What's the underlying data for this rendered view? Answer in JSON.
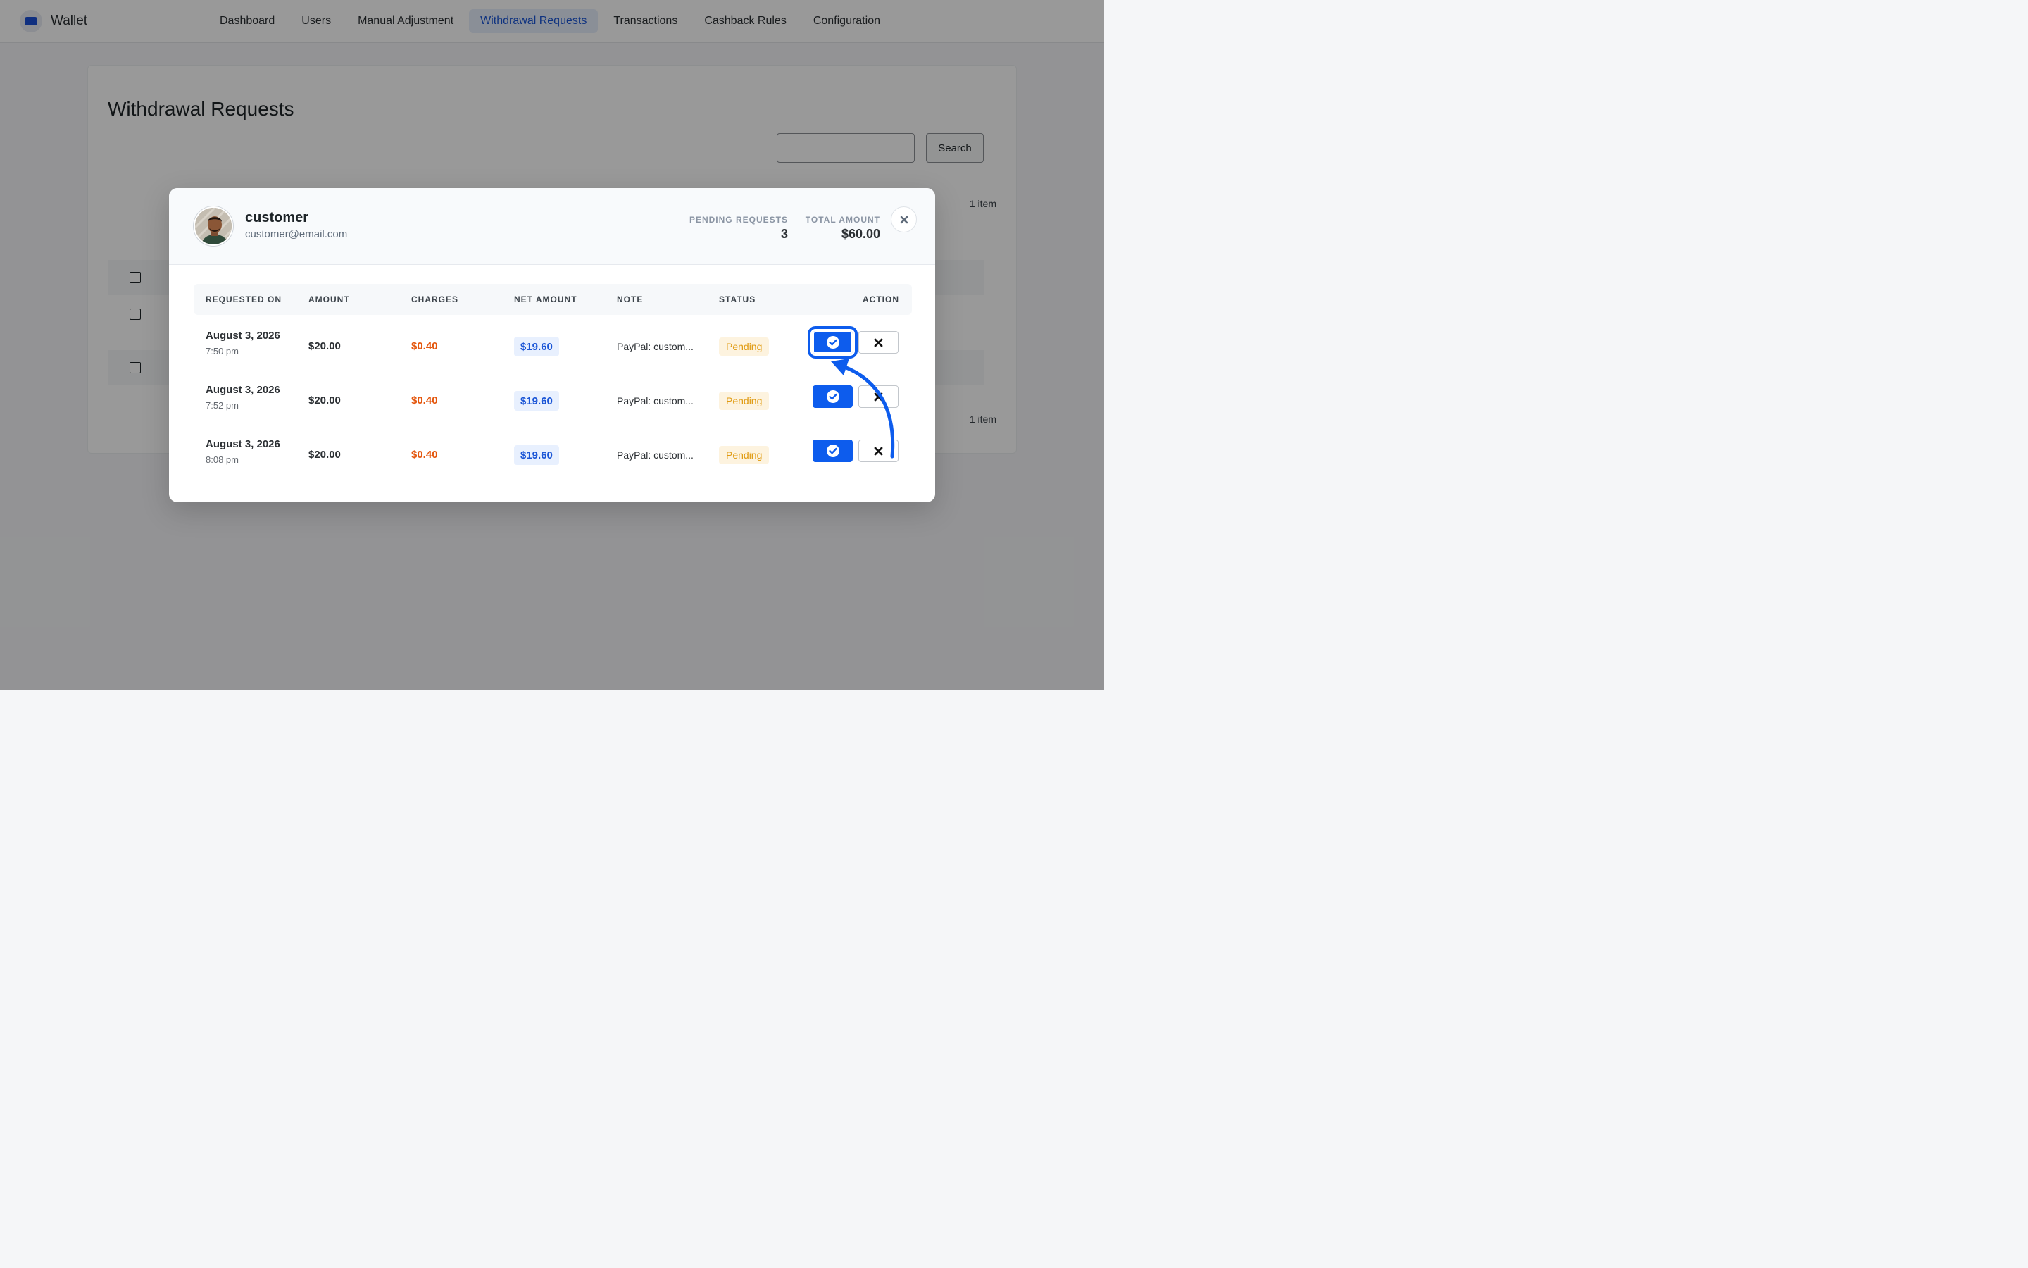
{
  "app": {
    "name": "Wallet"
  },
  "nav": {
    "items": [
      {
        "label": "Dashboard"
      },
      {
        "label": "Users"
      },
      {
        "label": "Manual Adjustment"
      },
      {
        "label": "Withdrawal Requests"
      },
      {
        "label": "Transactions"
      },
      {
        "label": "Cashback Rules"
      },
      {
        "label": "Configuration"
      }
    ],
    "active_index": 3
  },
  "page": {
    "title": "Withdrawal Requests",
    "search_button": "Search",
    "item_count_top": "1 item",
    "item_count_bottom": "1 item"
  },
  "modal": {
    "user_name": "customer",
    "user_email": "customer@email.com",
    "pending_label": "PENDING REQUESTS",
    "pending_value": "3",
    "total_label": "TOTAL AMOUNT",
    "total_value": "$60.00",
    "columns": [
      "REQUESTED ON",
      "AMOUNT",
      "CHARGES",
      "NET AMOUNT",
      "NOTE",
      "STATUS",
      "ACTION"
    ],
    "rows": [
      {
        "date": "August 3, 2026",
        "time": "7:50 pm",
        "amount": "$20.00",
        "charges": "$0.40",
        "net": "$19.60",
        "note": "PayPal: custom...",
        "status": "Pending"
      },
      {
        "date": "August 3, 2026",
        "time": "7:52 pm",
        "amount": "$20.00",
        "charges": "$0.40",
        "net": "$19.60",
        "note": "PayPal: custom...",
        "status": "Pending"
      },
      {
        "date": "August 3, 2026",
        "time": "8:08 pm",
        "amount": "$20.00",
        "charges": "$0.40",
        "net": "$19.60",
        "note": "PayPal: custom...",
        "status": "Pending"
      }
    ]
  },
  "colors": {
    "accent": "#0d5ced",
    "nav_active_bg": "#e7eefc",
    "charges": "#e4570e",
    "pending_text": "#e09b12",
    "pending_bg": "#fdf3df"
  },
  "icons": {
    "approve": "check-circle-icon",
    "reject": "x-icon",
    "close": "close-icon",
    "brand": "wallet-icon"
  }
}
